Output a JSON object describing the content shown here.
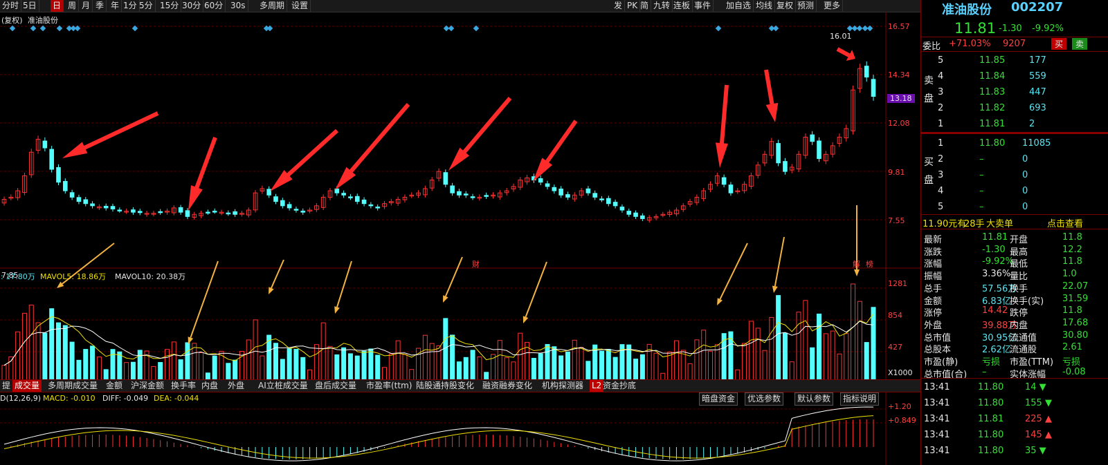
{
  "toolbar": {
    "left": [
      "分时",
      "5日",
      "日",
      "周",
      "月",
      "季",
      "年",
      "1分",
      "5分",
      "15分",
      "30分",
      "60分",
      "30s",
      "多周期",
      "设置"
    ],
    "active": "日",
    "right": [
      "发",
      "PK",
      "简",
      "九转",
      "连板",
      "事件",
      "加自选",
      "均线",
      "复权",
      "预测",
      "更多"
    ]
  },
  "chart": {
    "header_left": "(复权)",
    "stock_name": "准油股份",
    "price_axis": [
      "16.57",
      "14.34",
      "12.08",
      "9.81",
      "7.55"
    ],
    "current_tag": "13.18",
    "low_label": "7.85",
    "high_label": "16.01",
    "marker_cai": "财",
    "marker_bang": "榜",
    "marker_jian": "解",
    "vol_label_a": ": 17.80万",
    "vol_label_b": "MAVOL5: 18.86万",
    "vol_label_c": "MAVOL10: 20.38万",
    "vol_axis": [
      "1281",
      "854",
      "427",
      "X1000"
    ],
    "macd_label": "D(12,26,9)",
    "macd_val": "MACD: -0.010",
    "diff_val": "DIFF: -0.049",
    "dea_val": "DEA: -0.044",
    "macd_axis": [
      "+1.20",
      "+0.849"
    ],
    "colors": {
      "up": "#ff3232",
      "down": "#54ffff",
      "arrow_red": "#ff2a2a",
      "arrow_yellow": "#f2b340",
      "ma_white": "#ffffff",
      "ma_yellow": "#f0e000"
    }
  },
  "indicator_tabs": [
    "提",
    "成交量",
    "多周期成交量",
    "金额",
    "沪深金额",
    "换手率",
    "内盘",
    "外盘",
    "AI立桩成交量",
    "盘后成交量",
    "市盈率(ttm)",
    "陆股通持股变化",
    "融资融券变化",
    "机构探测器",
    "L2",
    "资金抄底"
  ],
  "macd_buttons": [
    "暗盘资金",
    "优选参数",
    "默认参数",
    "指标说明"
  ],
  "panel": {
    "name": "准油股份",
    "code": "002207",
    "price": "11.81",
    "change": "-1.30",
    "change_pct": "-9.92%",
    "weibi_label": "委比",
    "weibi": "+71.03%",
    "weicha": "9207",
    "buy_btn": "买",
    "sell_btn": "卖",
    "sell_side": "卖盘",
    "buy_side": "买盘",
    "asks": [
      {
        "lvl": "5",
        "price": "11.85",
        "vol": "177"
      },
      {
        "lvl": "4",
        "price": "11.84",
        "vol": "559"
      },
      {
        "lvl": "3",
        "price": "11.83",
        "vol": "447"
      },
      {
        "lvl": "2",
        "price": "11.82",
        "vol": "693"
      },
      {
        "lvl": "1",
        "price": "11.81",
        "vol": "2"
      }
    ],
    "bids": [
      {
        "lvl": "1",
        "price": "11.80",
        "vol": "11085"
      },
      {
        "lvl": "2",
        "price": "–",
        "vol": "0"
      },
      {
        "lvl": "3",
        "price": "–",
        "vol": "0"
      },
      {
        "lvl": "4",
        "price": "–",
        "vol": "0"
      },
      {
        "lvl": "5",
        "price": "–",
        "vol": "0"
      }
    ],
    "bigorder": {
      "price": "11.90元有",
      "hands": "28手",
      "type": "大卖单",
      "link": "点击查看"
    },
    "stats": [
      {
        "k1": "最新",
        "v1": "11.81",
        "k2": "开盘",
        "v2": "11.8"
      },
      {
        "k1": "涨跌",
        "v1": "-1.30",
        "k2": "最高",
        "v2": "12.2"
      },
      {
        "k1": "涨幅",
        "v1": "-9.92%",
        "k2": "最低",
        "v2": "11.8"
      },
      {
        "k1": "振幅",
        "v1": "3.36%",
        "k2": "量比",
        "v2": "1.0"
      },
      {
        "k1": "总手",
        "v1": "57.56万",
        "k2": "换手",
        "v2": "22.07"
      },
      {
        "k1": "金额",
        "v1": "6.83亿",
        "k2": "换手(实)",
        "v2": "31.59"
      },
      {
        "k1": "涨停",
        "v1": "14.42",
        "k2": "跌停",
        "v2": "11.8"
      },
      {
        "k1": "外盘",
        "v1": "39.88万",
        "k2": "内盘",
        "v2": "17.68"
      },
      {
        "k1": "总市值",
        "v1": "30.95亿",
        "k2": "流通值",
        "v2": "30.80"
      },
      {
        "k1": "总股本",
        "v1": "2.62亿",
        "k2": "流通股",
        "v2": "2.61"
      },
      {
        "k1": "市盈(静)",
        "v1": "亏损",
        "k2": "市盈(TTM)",
        "v2": "亏损"
      },
      {
        "k1": "总市值(合)",
        "v1": "–",
        "k2": "实体涨幅",
        "v2": "-0.08"
      }
    ],
    "ticks": [
      {
        "time": "13:41",
        "price": "11.80",
        "vol": "14",
        "dir": "down"
      },
      {
        "time": "13:41",
        "price": "11.80",
        "vol": "155",
        "dir": "down"
      },
      {
        "time": "13:41",
        "price": "11.81",
        "vol": "225",
        "dir": "up"
      },
      {
        "time": "13:41",
        "price": "11.80",
        "vol": "145",
        "dir": "up"
      },
      {
        "time": "13:41",
        "price": "11.80",
        "vol": "35",
        "dir": "down"
      }
    ]
  }
}
